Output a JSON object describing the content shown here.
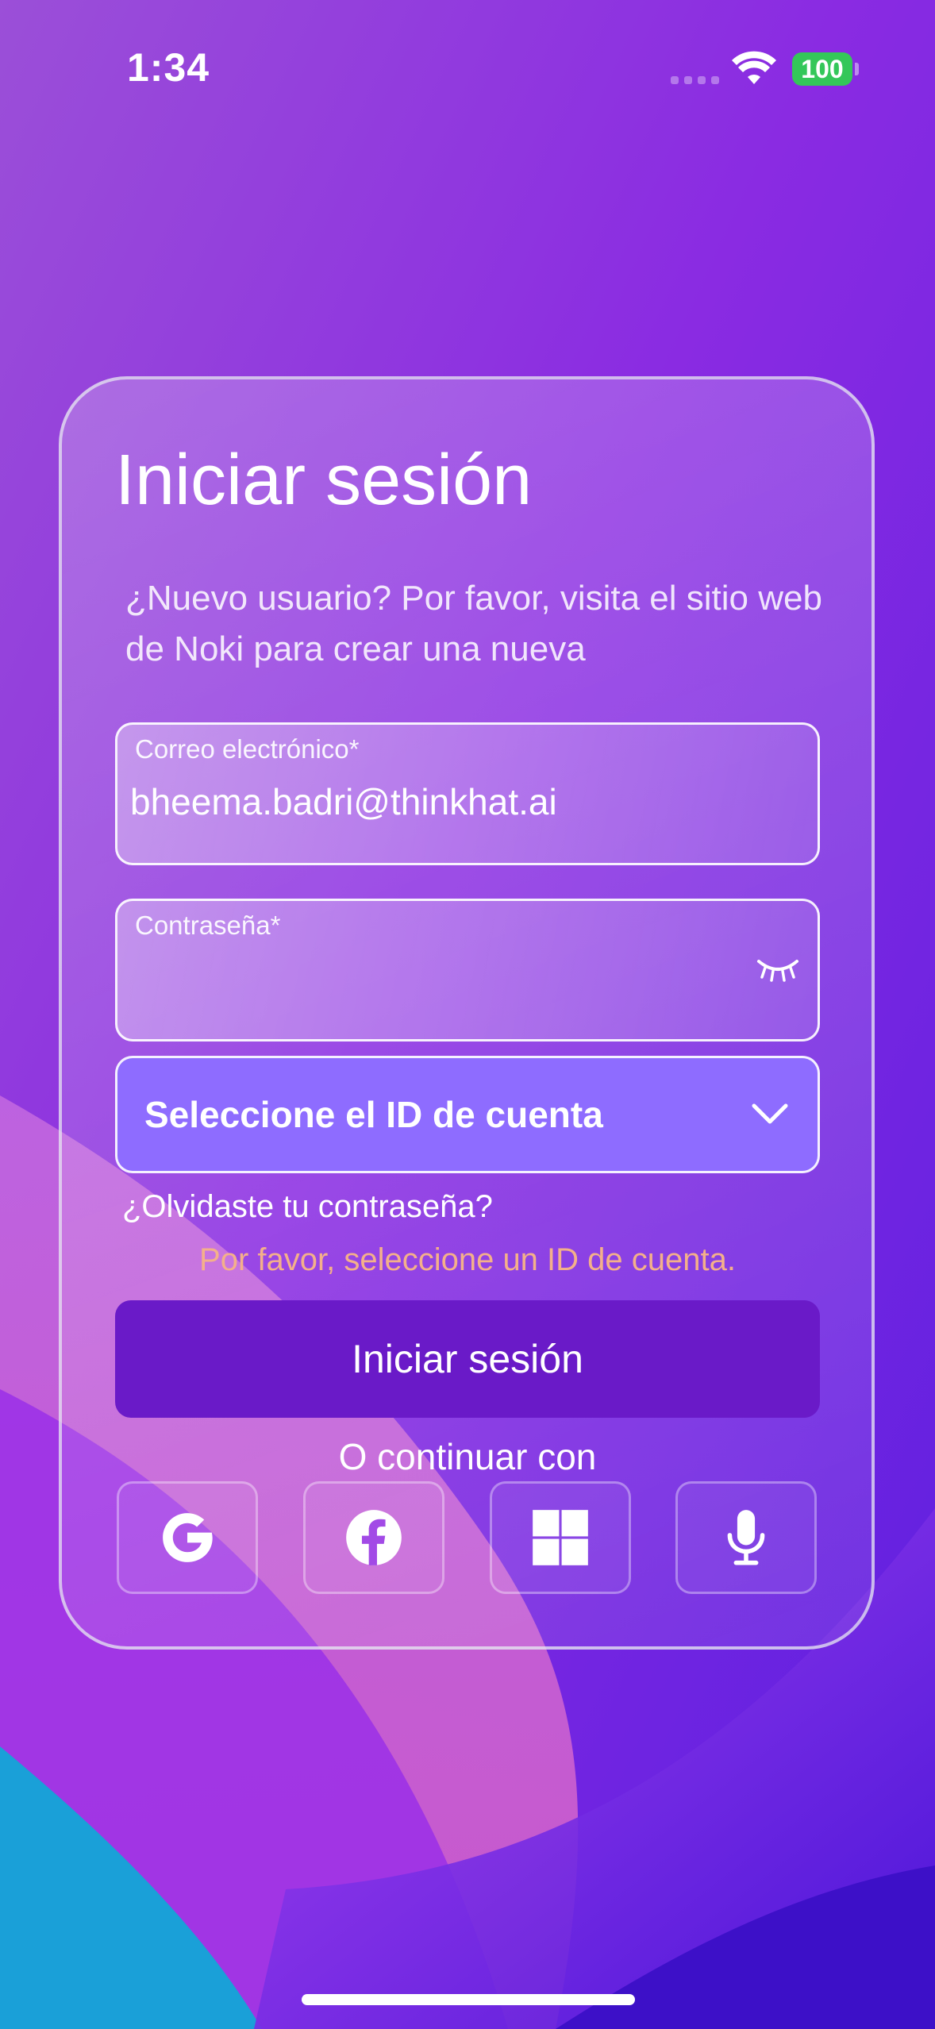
{
  "status_bar": {
    "time": "1:34",
    "battery": "100"
  },
  "login": {
    "title": "Iniciar sesión",
    "subtitle": "¿Nuevo usuario? Por favor, visita el sitio web de Noki para crear una nueva",
    "email_label": "Correo electrónico*",
    "email_value": "bheema.badri@thinkhat.ai",
    "password_label": "Contraseña*",
    "password_value": "",
    "account_select": "Seleccione el ID de cuenta",
    "forgot_password": "¿Olvidaste tu contraseña?",
    "error_message": "Por favor, seleccione un ID de cuenta.",
    "submit_label": "Iniciar sesión",
    "divider_text": "O continuar con"
  },
  "social_providers": [
    "google-icon",
    "facebook-icon",
    "windows-icon",
    "microphone-icon"
  ],
  "colors": {
    "button": "#6a1ac8",
    "select": "#8e6cff",
    "error": "#f4b08a",
    "battery": "#34c759"
  }
}
